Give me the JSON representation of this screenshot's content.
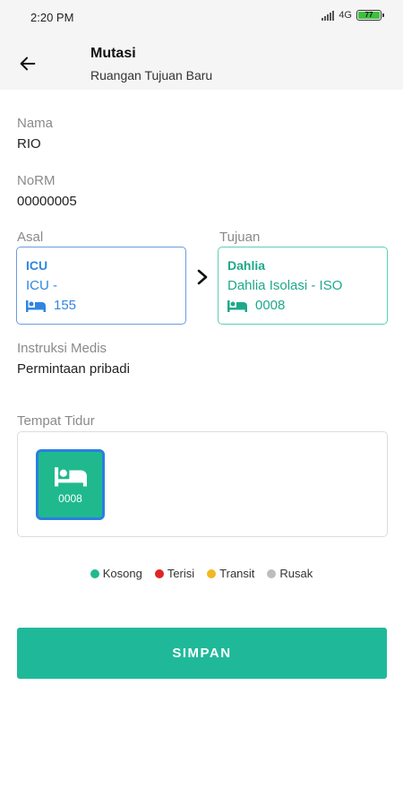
{
  "status_bar": {
    "time": "2:20 PM",
    "network": "4G",
    "battery": "77"
  },
  "header": {
    "title": "Mutasi",
    "subtitle": "Ruangan Tujuan Baru"
  },
  "patient": {
    "name_label": "Nama",
    "name_value": "RIO",
    "norm_label": "NoRM",
    "norm_value": "00000005"
  },
  "origin": {
    "label": "Asal",
    "room": "ICU",
    "detail": "ICU -",
    "bed": "155"
  },
  "destination": {
    "label": "Tujuan",
    "room": "Dahlia",
    "detail": "Dahlia Isolasi - ISO",
    "bed": "0008"
  },
  "instruction": {
    "label": "Instruksi Medis",
    "value": "Permintaan pribadi"
  },
  "bed_section": {
    "label": "Tempat Tidur",
    "beds": [
      {
        "number": "0008",
        "status": "kosong"
      }
    ]
  },
  "legend": [
    {
      "label": "Kosong",
      "color": "#20b98e"
    },
    {
      "label": "Terisi",
      "color": "#e02424"
    },
    {
      "label": "Transit",
      "color": "#f2b824"
    },
    {
      "label": "Rusak",
      "color": "#bdbdbd"
    }
  ],
  "actions": {
    "save_label": "SIMPAN"
  },
  "icons": {
    "back": "arrow-left-icon",
    "next": "chevron-right-icon",
    "bed": "bed-icon"
  }
}
